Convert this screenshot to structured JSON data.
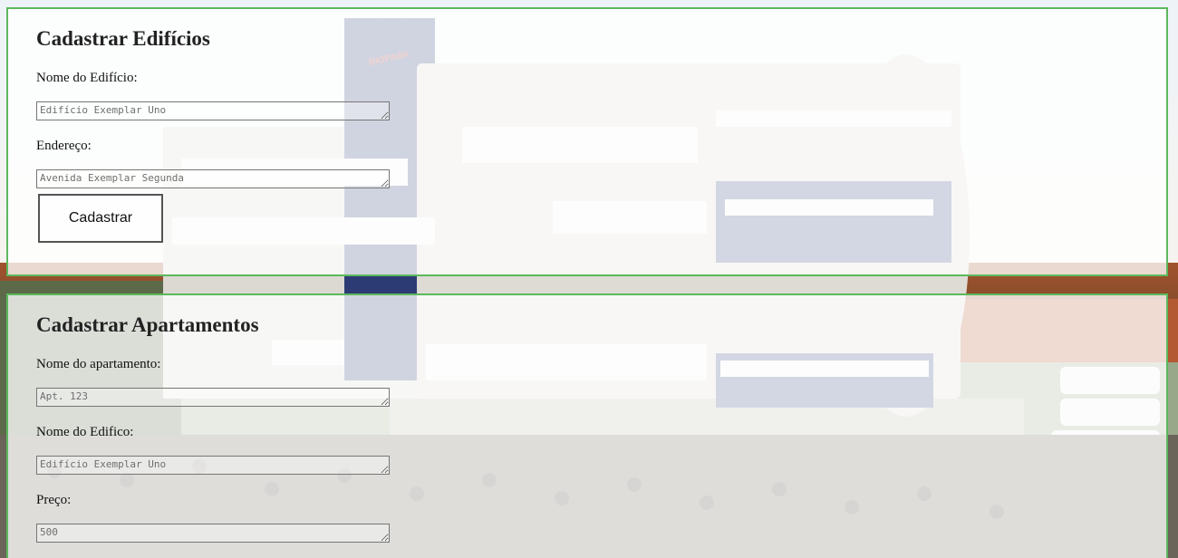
{
  "building_form": {
    "title": "Cadastrar Edifícios",
    "name_label": "Nome do Edifício:",
    "name_placeholder": "Edifício Exemplar Uno",
    "address_label": "Endereço:",
    "address_placeholder": "Avenida Exemplar Segunda",
    "submit_label": "Cadastrar"
  },
  "apartment_form": {
    "title": "Cadastrar Apartamentos",
    "apt_name_label": "Nome do apartamento:",
    "apt_name_placeholder": "Apt. 123",
    "building_name_label": "Nome do Edifico:",
    "building_name_placeholder": "Edifício Exemplar Uno",
    "price_label": "Preço:",
    "price_placeholder": "500"
  },
  "background": {
    "logo_text": "BIOPARK",
    "accent_color": "#5cb85c"
  }
}
